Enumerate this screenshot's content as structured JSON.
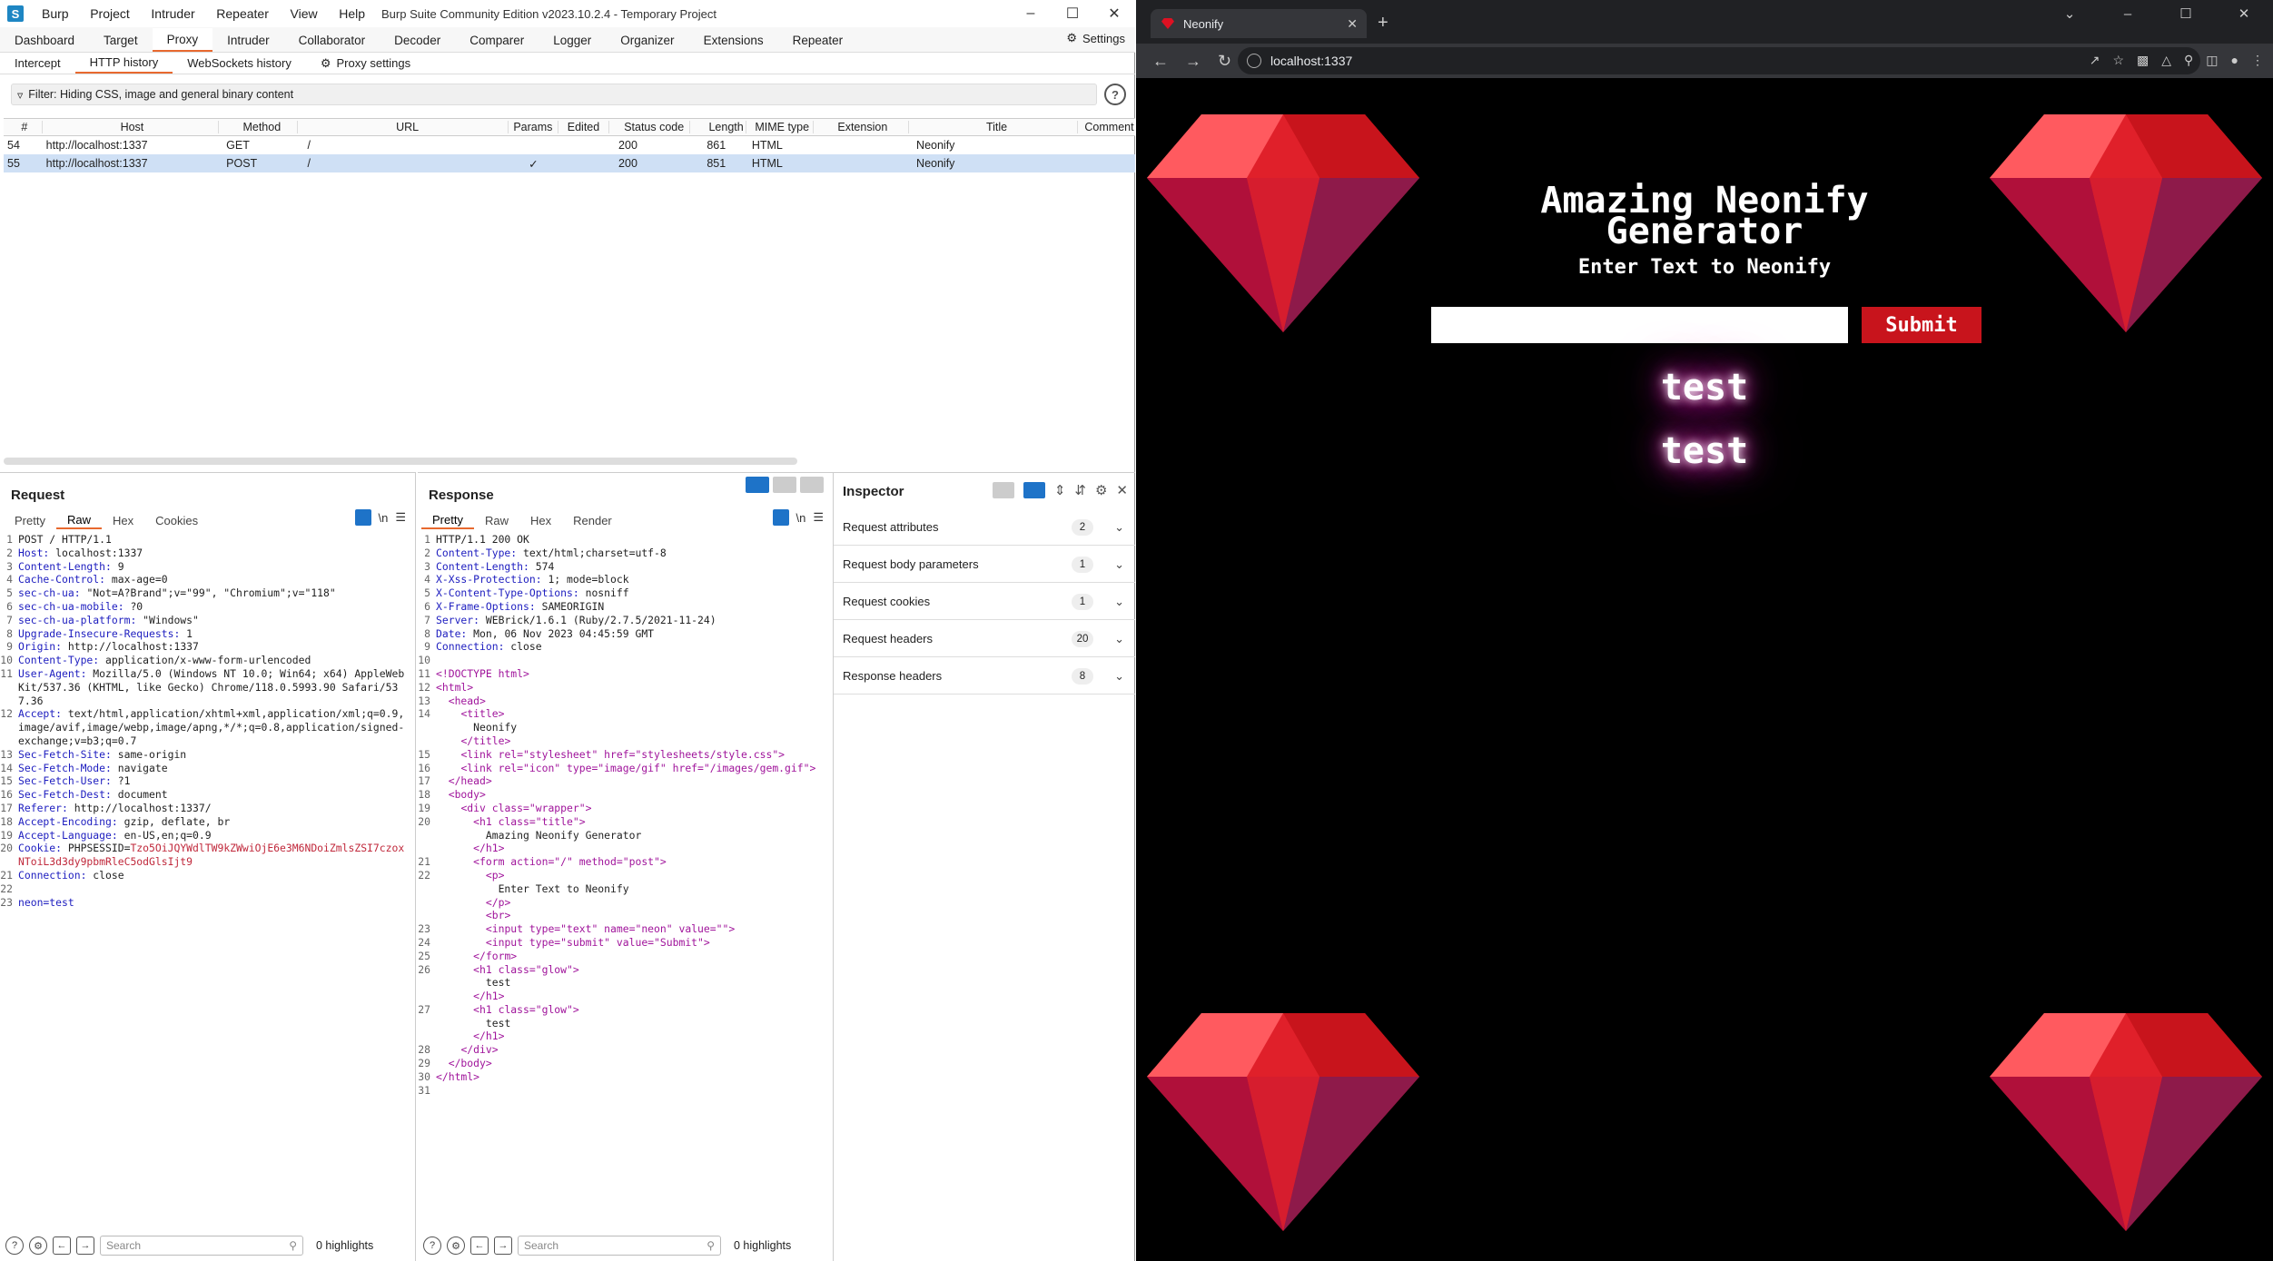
{
  "burp": {
    "menu": [
      "Burp",
      "Project",
      "Intruder",
      "Repeater",
      "View",
      "Help"
    ],
    "window_title": "Burp Suite Community Edition v2023.10.2.4 - Temporary Project",
    "main_tabs": [
      "Dashboard",
      "Target",
      "Proxy",
      "Intruder",
      "Collaborator",
      "Decoder",
      "Comparer",
      "Logger",
      "Organizer",
      "Extensions",
      "Repeater"
    ],
    "settings_label": "Settings",
    "sub_tabs": [
      "Intercept",
      "HTTP history",
      "WebSockets history"
    ],
    "proxy_settings_label": "Proxy settings",
    "filter_text": "Filter: Hiding CSS, image and general binary content",
    "table": {
      "headers": [
        "#",
        "Host",
        "Method",
        "URL",
        "Params",
        "Edited",
        "Status code",
        "Length",
        "MIME type",
        "Extension",
        "Title",
        "Comment"
      ],
      "rows": [
        {
          "num": "54",
          "host": "http://localhost:1337",
          "method": "GET",
          "url": "/",
          "params": "",
          "edited": "",
          "status": "200",
          "length": "861",
          "mime": "HTML",
          "ext": "",
          "title": "Neonify",
          "comment": ""
        },
        {
          "num": "55",
          "host": "http://localhost:1337",
          "method": "POST",
          "url": "/",
          "params": "✓",
          "edited": "",
          "status": "200",
          "length": "851",
          "mime": "HTML",
          "ext": "",
          "title": "Neonify",
          "comment": ""
        }
      ]
    },
    "request": {
      "title": "Request",
      "tabs": [
        "Pretty",
        "Raw",
        "Hex",
        "Cookies"
      ],
      "newline_label": "\\n",
      "lines": [
        {
          "n": "1",
          "k": "",
          "v": "POST / HTTP/1.1"
        },
        {
          "n": "2",
          "k": "Host: ",
          "v": "localhost:1337"
        },
        {
          "n": "3",
          "k": "Content-Length: ",
          "v": "9"
        },
        {
          "n": "4",
          "k": "Cache-Control: ",
          "v": "max-age=0"
        },
        {
          "n": "5",
          "k": "sec-ch-ua: ",
          "v": "\"Not=A?Brand\";v=\"99\", \"Chromium\";v=\"118\""
        },
        {
          "n": "6",
          "k": "sec-ch-ua-mobile: ",
          "v": "?0"
        },
        {
          "n": "7",
          "k": "sec-ch-ua-platform: ",
          "v": "\"Windows\""
        },
        {
          "n": "8",
          "k": "Upgrade-Insecure-Requests: ",
          "v": "1"
        },
        {
          "n": "9",
          "k": "Origin: ",
          "v": "http://localhost:1337"
        },
        {
          "n": "10",
          "k": "Content-Type: ",
          "v": "application/x-www-form-urlencoded"
        },
        {
          "n": "11",
          "k": "User-Agent: ",
          "v": "Mozilla/5.0 (Windows NT 10.0; Win64; x64) AppleWebKit/537.36 (KHTML, like Gecko) Chrome/118.0.5993.90 Safari/537.36"
        },
        {
          "n": "12",
          "k": "Accept: ",
          "v": "text/html,application/xhtml+xml,application/xml;q=0.9,image/avif,image/webp,image/apng,*/*;q=0.8,application/signed-exchange;v=b3;q=0.7"
        },
        {
          "n": "13",
          "k": "Sec-Fetch-Site: ",
          "v": "same-origin"
        },
        {
          "n": "14",
          "k": "Sec-Fetch-Mode: ",
          "v": "navigate"
        },
        {
          "n": "15",
          "k": "Sec-Fetch-User: ",
          "v": "?1"
        },
        {
          "n": "16",
          "k": "Sec-Fetch-Dest: ",
          "v": "document"
        },
        {
          "n": "17",
          "k": "Referer: ",
          "v": "http://localhost:1337/"
        },
        {
          "n": "18",
          "k": "Accept-Encoding: ",
          "v": "gzip, deflate, br"
        },
        {
          "n": "19",
          "k": "Accept-Language: ",
          "v": "en-US,en;q=0.9"
        },
        {
          "n": "20",
          "k": "Cookie: ",
          "v": "PHPSESSID=",
          "c": "Tzo5OiJQYWdlTW9kZWwiOjE6e3M6NDoiZmlsZSI7czoxNToiL3d3dy9pbmRleC5odGlsIjt9"
        },
        {
          "n": "21",
          "k": "Connection: ",
          "v": "close"
        },
        {
          "n": "22",
          "k": "",
          "v": ""
        },
        {
          "n": "23",
          "k": "",
          "v": "",
          "body": "neon=test"
        }
      ],
      "search_placeholder": "Search",
      "highlights": "0 highlights"
    },
    "response": {
      "title": "Response",
      "tabs": [
        "Pretty",
        "Raw",
        "Hex",
        "Render"
      ],
      "newline_label": "\\n",
      "headers": [
        {
          "n": "1",
          "k": "",
          "v": "HTTP/1.1 200 OK"
        },
        {
          "n": "2",
          "k": "Content-Type: ",
          "v": "text/html;charset=utf-8"
        },
        {
          "n": "3",
          "k": "Content-Length: ",
          "v": "574"
        },
        {
          "n": "4",
          "k": "X-Xss-Protection: ",
          "v": "1; mode=block"
        },
        {
          "n": "5",
          "k": "X-Content-Type-Options: ",
          "v": "nosniff"
        },
        {
          "n": "6",
          "k": "X-Frame-Options: ",
          "v": "SAMEORIGIN"
        },
        {
          "n": "7",
          "k": "Server: ",
          "v": "WEBrick/1.6.1 (Ruby/2.7.5/2021-11-24)"
        },
        {
          "n": "8",
          "k": "Date: ",
          "v": "Mon, 06 Nov 2023 04:45:59 GMT"
        },
        {
          "n": "9",
          "k": "Connection: ",
          "v": "close"
        },
        {
          "n": "10",
          "k": "",
          "v": ""
        }
      ],
      "html_lines": [
        {
          "n": "11",
          "t": "<!DOCTYPE html>"
        },
        {
          "n": "12",
          "t": "<html>"
        },
        {
          "n": "13",
          "t": "  <head>"
        },
        {
          "n": "14",
          "t": "    <title>"
        },
        {
          "n": "",
          "t": "      Neonify"
        },
        {
          "n": "",
          "t": "    </title>"
        },
        {
          "n": "15",
          "t": "    <link rel=\"stylesheet\" href=\"stylesheets/style.css\">"
        },
        {
          "n": "16",
          "t": "    <link rel=\"icon\" type=\"image/gif\" href=\"/images/gem.gif\">"
        },
        {
          "n": "17",
          "t": "  </head>"
        },
        {
          "n": "18",
          "t": "  <body>"
        },
        {
          "n": "19",
          "t": "    <div class=\"wrapper\">"
        },
        {
          "n": "20",
          "t": "      <h1 class=\"title\">"
        },
        {
          "n": "",
          "t": "        Amazing Neonify Generator"
        },
        {
          "n": "",
          "t": "      </h1>"
        },
        {
          "n": "21",
          "t": "      <form action=\"/\" method=\"post\">"
        },
        {
          "n": "22",
          "t": "        <p>"
        },
        {
          "n": "",
          "t": "          Enter Text to Neonify"
        },
        {
          "n": "",
          "t": "        </p>"
        },
        {
          "n": "",
          "t": "        <br>"
        },
        {
          "n": "23",
          "t": "        <input type=\"text\" name=\"neon\" value=\"\">"
        },
        {
          "n": "24",
          "t": "        <input type=\"submit\" value=\"Submit\">"
        },
        {
          "n": "25",
          "t": "      </form>"
        },
        {
          "n": "26",
          "t": "      <h1 class=\"glow\">"
        },
        {
          "n": "",
          "t": "        test"
        },
        {
          "n": "",
          "t": "      </h1>"
        },
        {
          "n": "27",
          "t": "      <h1 class=\"glow\">"
        },
        {
          "n": "",
          "t": "        test"
        },
        {
          "n": "",
          "t": "      </h1>"
        },
        {
          "n": "28",
          "t": "    </div>"
        },
        {
          "n": "29",
          "t": "  </body>"
        },
        {
          "n": "30",
          "t": "</html>"
        },
        {
          "n": "31",
          "t": ""
        }
      ],
      "search_placeholder": "Search",
      "highlights": "0 highlights"
    },
    "inspector": {
      "title": "Inspector",
      "sections": [
        {
          "label": "Request attributes",
          "count": "2"
        },
        {
          "label": "Request body parameters",
          "count": "1"
        },
        {
          "label": "Request cookies",
          "count": "1"
        },
        {
          "label": "Request headers",
          "count": "20"
        },
        {
          "label": "Response headers",
          "count": "8"
        }
      ]
    }
  },
  "chrome": {
    "tab_title": "Neonify",
    "url": "localhost:1337",
    "page": {
      "title_line1": "Amazing Neonify",
      "title_line2": "Generator",
      "subtitle": "Enter Text to Neonify",
      "input_value": "",
      "submit_label": "Submit",
      "glow": [
        "test",
        "test"
      ]
    }
  },
  "colors": {
    "accent": "#e8692f",
    "selection": "#cfe0f5",
    "gem_red": "#e0202a",
    "submit_red": "#c8141c",
    "glow_pink": "#ff3fcf"
  }
}
